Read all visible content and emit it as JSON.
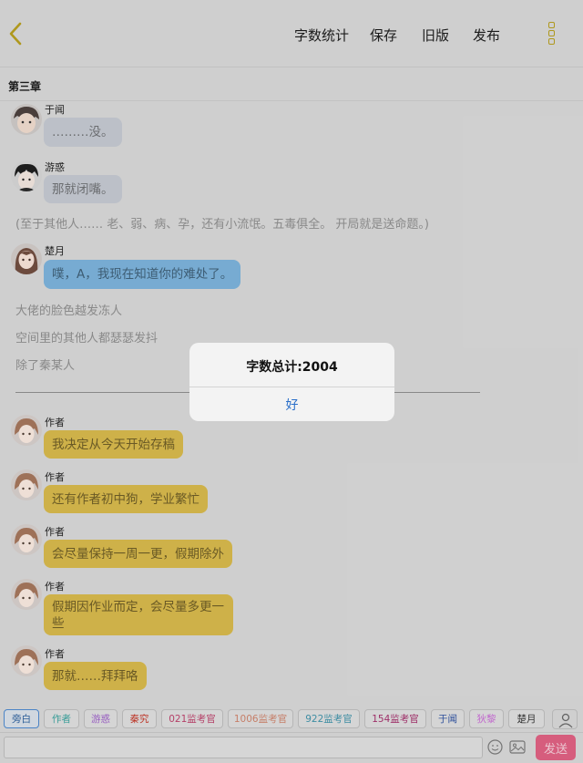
{
  "toolbar": {
    "word_count": "字数统计",
    "save": "保存",
    "old_version": "旧版",
    "publish": "发布"
  },
  "chapter_title": "第三章",
  "messages": [
    {
      "name": "于闻",
      "text": "………没。",
      "style": "gray"
    },
    {
      "name": "游惑",
      "text": "那就闭嘴。",
      "style": "gray"
    },
    {
      "text": "(至于其他人…… 老、弱、病、孕，还有小流氓。五毒俱全。 开局就是送命题。)"
    },
    {
      "name": "楚月",
      "text": "噗，A，我现在知道你的难处了。",
      "style": "blue"
    },
    {
      "text": "大佬的脸色越发冻人"
    },
    {
      "text": "空间里的其他人都瑟瑟发抖"
    },
    {
      "text": "除了秦某人"
    },
    {
      "name": "作者",
      "text": "我决定从今天开始存稿",
      "style": "yellow"
    },
    {
      "name": "作者",
      "text": "还有作者初中狗，学业繁忙",
      "style": "yellow"
    },
    {
      "name": "作者",
      "text": "会尽量保持一周一更，假期除外",
      "style": "yellow"
    },
    {
      "name": "作者",
      "text": "假期因作业而定，会尽量多更一些",
      "style": "yellow"
    },
    {
      "name": "作者",
      "text": "那就……拜拜咯",
      "style": "yellow"
    }
  ],
  "dialog": {
    "title": "字数总计:2004",
    "ok": "好"
  },
  "roles": [
    {
      "label": "旁白",
      "color": "#2b5e98"
    },
    {
      "label": "作者",
      "color": "#3a9f9a"
    },
    {
      "label": "游惑",
      "color": "#9b62c4"
    },
    {
      "label": "秦究",
      "color": "#c0392b"
    },
    {
      "label": "021监考官",
      "color": "#b8426a"
    },
    {
      "label": "1006监考官",
      "color": "#c9806a"
    },
    {
      "label": "922监考官",
      "color": "#3f8fa5"
    },
    {
      "label": "154监考官",
      "color": "#a0306a"
    },
    {
      "label": "于闻",
      "color": "#2d4f9c"
    },
    {
      "label": "狄黎",
      "color": "#c46ad0"
    },
    {
      "label": "楚月",
      "color": "#333333"
    }
  ],
  "input": {
    "placeholder": ""
  },
  "send_label": "发送",
  "colors": {
    "accent": "#d95f7f",
    "author_bubble": "#d1b44a",
    "link": "#2a6fc9"
  }
}
